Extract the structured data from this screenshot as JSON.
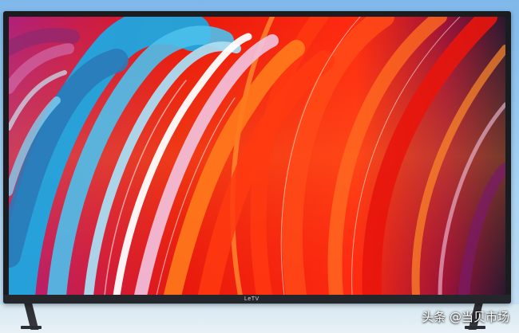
{
  "tv": {
    "brand_logo": "LeTV",
    "bezel_color": "#1b1c20",
    "wallpaper_colors": [
      "#ff3a10",
      "#e8180c",
      "#ff7a1c",
      "#1fa8e0",
      "#a9dcf2",
      "#f2c4e0",
      "#7b1a6a"
    ]
  },
  "background": {
    "wall_color": "#9ecdf0",
    "floor_color": "#e3eef5"
  },
  "watermark": {
    "text": "头条 @当贝市场"
  }
}
